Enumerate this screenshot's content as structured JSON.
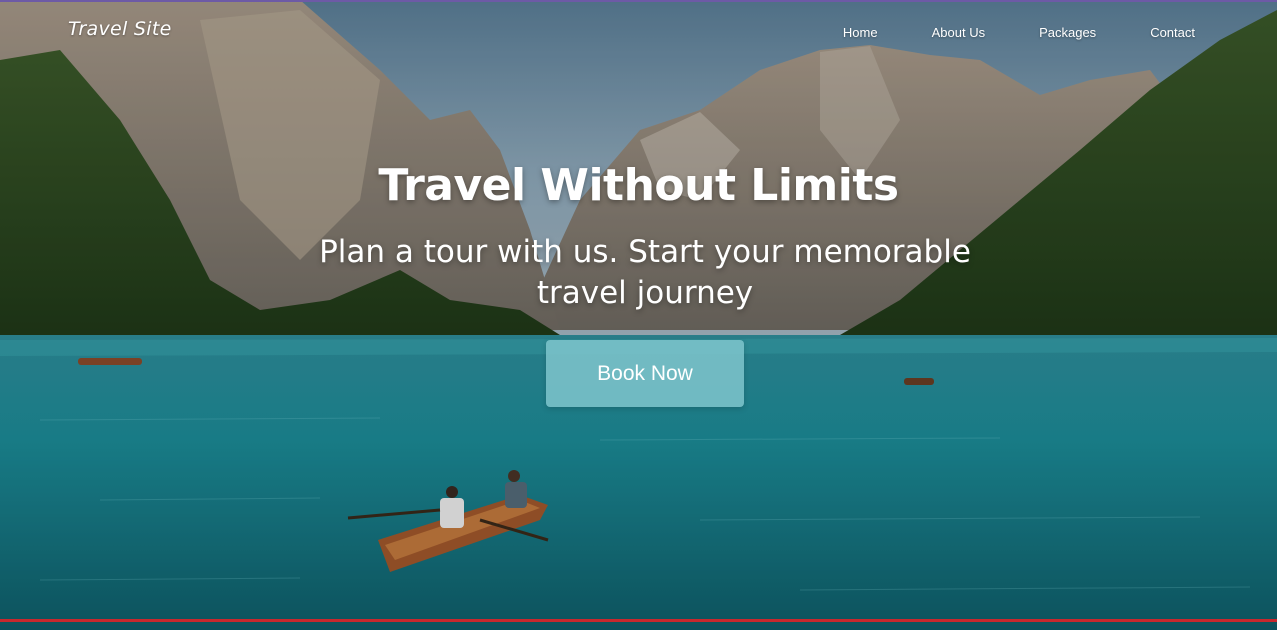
{
  "site": {
    "logo": "Travel Site"
  },
  "nav": {
    "items": [
      {
        "label": "Home"
      },
      {
        "label": "About Us"
      },
      {
        "label": "Packages"
      },
      {
        "label": "Contact"
      }
    ]
  },
  "hero": {
    "headline": "Travel Without Limits",
    "subhead": "Plan a tour with us. Start your memorable travel journey",
    "cta_label": "Book Now",
    "background_description_icon": "mountain-lake-photo"
  },
  "colors": {
    "accent_top": "#6d5aa6",
    "accent_bottom": "#c8282d",
    "cta": "#7fc6cd",
    "text": "#ffffff"
  }
}
